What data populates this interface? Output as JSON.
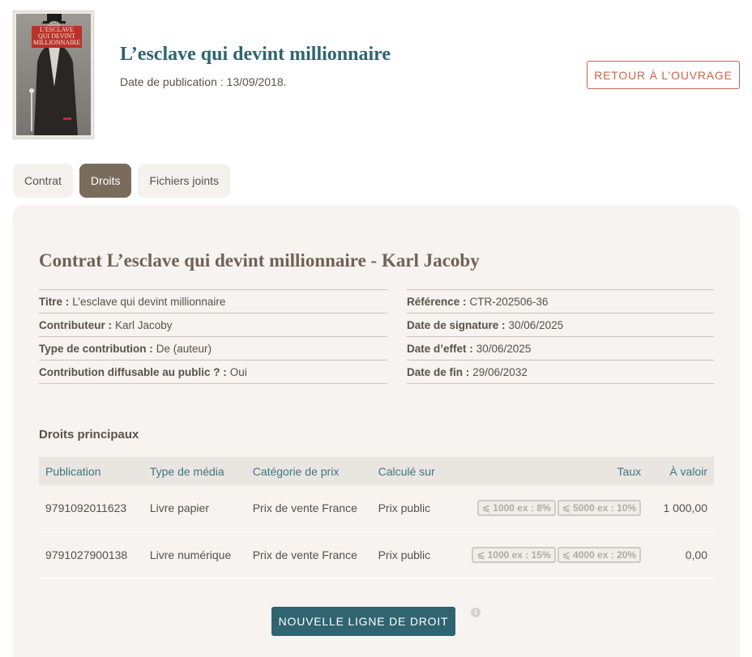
{
  "book": {
    "title": "L’esclave qui devint millionnaire",
    "publication_date": "Date de publication : 13/09/2018.",
    "cover": {
      "author": "KARL JACOBY",
      "title_line1": "L’ESCLAVE",
      "title_line2": "QUI DEVINT",
      "title_line3": "MILLIONNAIRE"
    }
  },
  "header": {
    "back_button_label": "RETOUR À L’OUVRAGE"
  },
  "tabs": [
    {
      "label": "Contrat",
      "active": false
    },
    {
      "label": "Droits",
      "active": true
    },
    {
      "label": "Fichiers joints",
      "active": false
    }
  ],
  "contract": {
    "title": "Contrat L’esclave qui devint millionnaire - Karl Jacoby",
    "left": [
      {
        "key": "Titre :",
        "value": "L’esclave qui devint millionnaire"
      },
      {
        "key": "Contributeur :",
        "value": "Karl Jacoby"
      },
      {
        "key": "Type de contribution :",
        "value": "De (auteur)"
      },
      {
        "key": "Contribution diffusable au public ? :",
        "value": "Oui"
      }
    ],
    "right": [
      {
        "key": "Référence :",
        "value": "CTR-202506-36"
      },
      {
        "key": "Date de signature :",
        "value": "30/06/2025"
      },
      {
        "key": "Date d’effet :",
        "value": "30/06/2025"
      },
      {
        "key": "Date de fin :",
        "value": "29/06/2032"
      }
    ]
  },
  "rights": {
    "section_title": "Droits principaux",
    "columns": [
      "Publication",
      "Type de média",
      "Catégorie de prix",
      "Calculé sur",
      "Taux",
      "À valoir"
    ],
    "rows": [
      {
        "publication": "9791092011623",
        "media_type": "Livre papier",
        "price_category": "Prix de vente France",
        "calculated_on": "Prix public",
        "rates": [
          "⩽ 1000 ex : 8%",
          "⩽ 5000 ex : 10%"
        ],
        "advance": "1 000,00"
      },
      {
        "publication": "9791027900138",
        "media_type": "Livre numérique",
        "price_category": "Prix de vente France",
        "calculated_on": "Prix public",
        "rates": [
          "⩽ 1000 ex : 15%",
          "⩽ 4000 ex : 20%"
        ],
        "advance": "0,00"
      }
    ],
    "new_line_button_label": "NOUVELLE LIGNE DE DROIT",
    "info_icon": "i"
  },
  "colors": {
    "accent": "#2c6470",
    "button": "#2f6470",
    "back_button": "#c9644a",
    "active_tab": "#7a6c5d",
    "panel": "#f6f3f0"
  }
}
